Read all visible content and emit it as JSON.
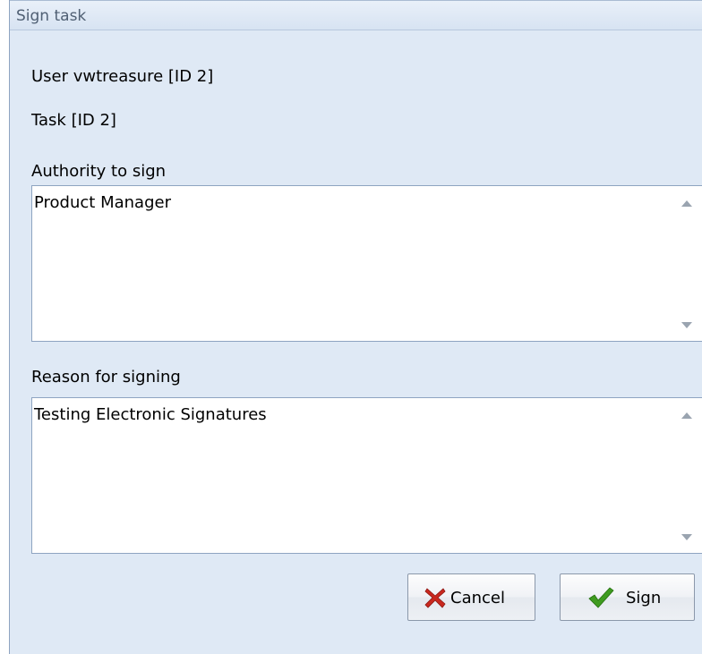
{
  "dialog": {
    "title": "Sign task",
    "user_line": "User vwtreasure [ID 2]",
    "task_line": "Task  [ID 2]",
    "authority": {
      "label": "Authority to sign",
      "value": "Product Manager"
    },
    "reason": {
      "label": "Reason for signing",
      "value": "Testing Electronic Signatures"
    },
    "buttons": {
      "cancel_label": "Cancel",
      "cancel_icon": "x-icon",
      "sign_label": "Sign",
      "sign_icon": "checkmark-icon"
    }
  },
  "colors": {
    "dialog_background": "#dfe9f5",
    "title_text": "#4f5f73",
    "cancel_icon": "#c9281f",
    "sign_icon": "#3f9b20"
  }
}
